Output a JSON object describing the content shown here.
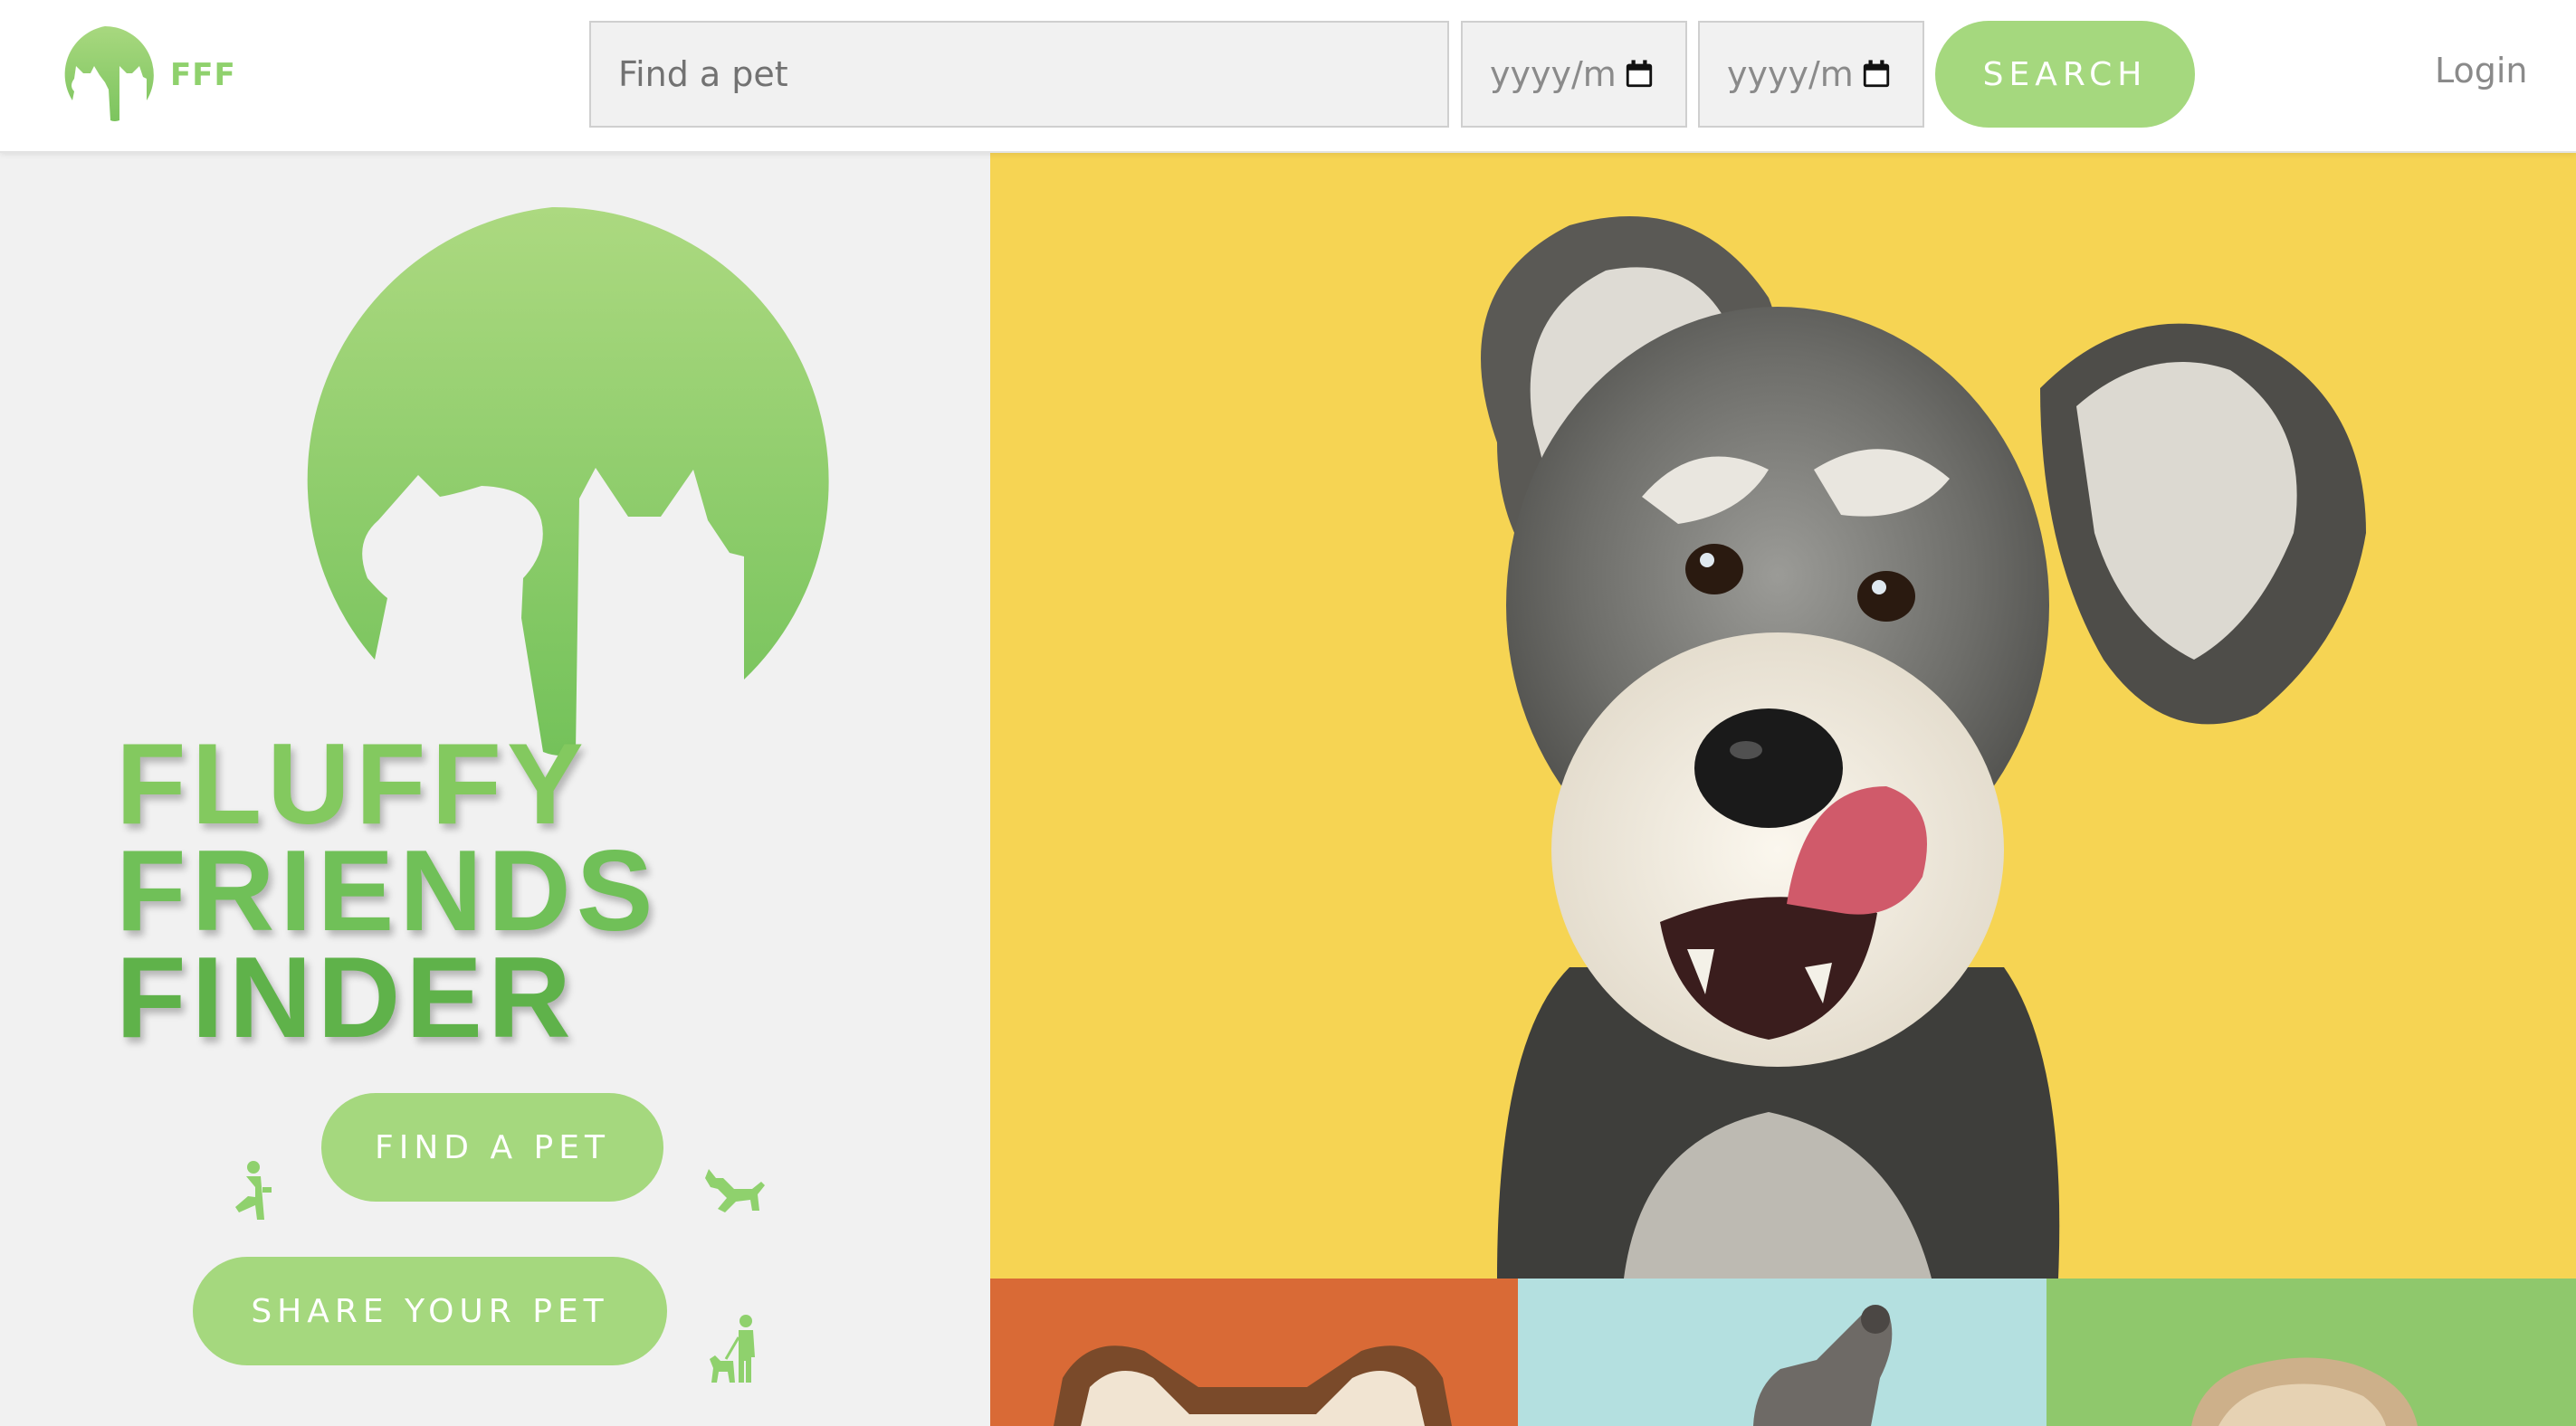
{
  "header": {
    "brand_text": "FFF",
    "search_placeholder": "Find a pet",
    "date_from_placeholder": "yyyy/m",
    "date_to_placeholder": "yyyy/m",
    "search_button": "SEARCH",
    "login_link": "Login"
  },
  "hero": {
    "title_lines": [
      "FLUFFY",
      "FRIENDS",
      "FINDER"
    ],
    "find_button": "FIND A PET",
    "share_button": "SHARE YOUR PET"
  },
  "icons": {
    "logo": "cat-silhouettes-moon-logo",
    "calendar": "calendar-icon",
    "kneeling_person": "kneeling-person-icon",
    "running_dog": "running-dog-icon",
    "person_with_dog": "person-with-dog-icon"
  },
  "colors": {
    "accent": "#a5d87e",
    "title_green": "#6cbf50",
    "header_bg": "#ffffff",
    "page_bg": "#f1f1f1",
    "main_photo_bg": "#f6d453",
    "thumb_1_bg": "#d96a36",
    "thumb_2_bg": "#b4e0e0",
    "thumb_3_bg": "#8fc86c"
  },
  "photos": {
    "main": "schnauzer-dog-photo",
    "thumbnails": [
      "corgi-dog-photo",
      "cat-paw-photo",
      "fluffy-dog-photo"
    ]
  }
}
